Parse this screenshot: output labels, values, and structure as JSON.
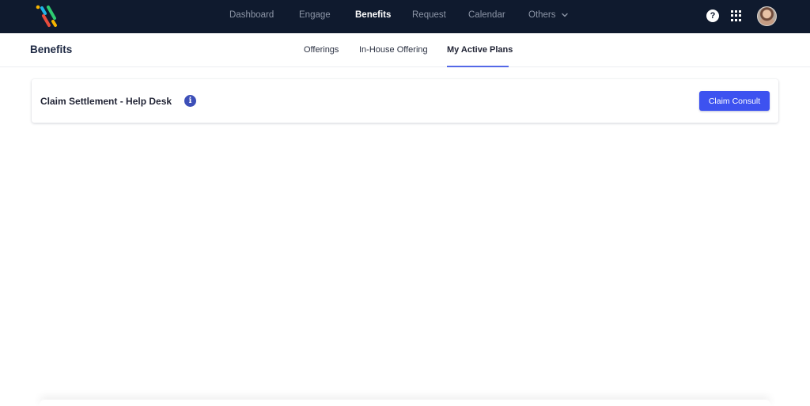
{
  "nav": {
    "items": [
      {
        "label": "Dashboard",
        "active": false
      },
      {
        "label": "Engage",
        "active": false
      },
      {
        "label": "Benefits",
        "active": true
      },
      {
        "label": "Request",
        "active": false
      },
      {
        "label": "Calendar",
        "active": false
      },
      {
        "label": "Others",
        "active": false
      }
    ],
    "help_label": "?",
    "logo_colors": [
      "#f7b500",
      "#1fb4e6",
      "#2ecc71",
      "#e74c3c"
    ]
  },
  "header": {
    "title": "Benefits",
    "tabs": [
      {
        "label": "Offerings",
        "active": false
      },
      {
        "label": "In-House Offering",
        "active": false
      },
      {
        "label": "My Active Plans",
        "active": true
      }
    ]
  },
  "card": {
    "title": "Claim Settlement - Help Desk",
    "info_label": "i",
    "button_label": "Claim Consult"
  },
  "colors": {
    "nav_bg": "#0f1a2e",
    "accent": "#3d52f0",
    "tab_underline": "#5468e7",
    "info": "#3d4fb8"
  }
}
